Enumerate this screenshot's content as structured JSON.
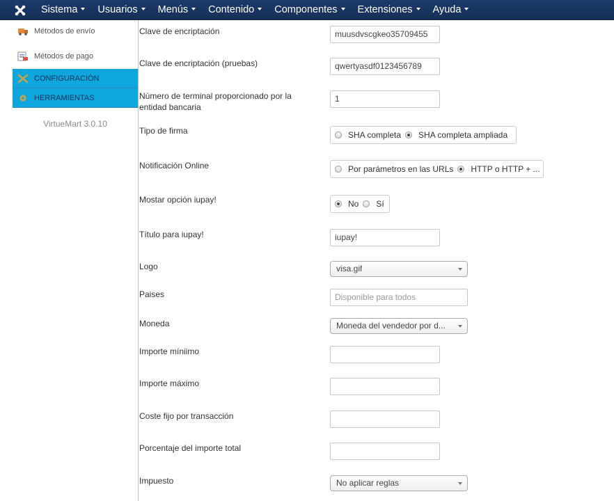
{
  "navbar": {
    "menu": [
      "Sistema",
      "Usuarios",
      "Menús",
      "Contenido",
      "Componentes",
      "Extensiones",
      "Ayuda"
    ]
  },
  "sidebar": {
    "items": [
      {
        "label": "Métodos de envío",
        "icon": "truck-icon"
      },
      {
        "label": "Métodos de pago",
        "icon": "payment-icon"
      },
      {
        "label": "CONFIGURACIÓN",
        "icon": "config-icon"
      },
      {
        "label": "HERRAMIENTAS",
        "icon": "tools-icon"
      }
    ],
    "version": "VirtueMart 3.0.10"
  },
  "form": {
    "encryption_key": {
      "label": "Clave de encriptación",
      "value": "muusdvscgkeo35709455"
    },
    "encryption_key_test": {
      "label": "Clave de encriptación (pruebas)",
      "value": "qwertyasdf0123456789"
    },
    "terminal": {
      "label_line1": "Número de terminal proporcionado por la",
      "label_line2": "entidad bancaria",
      "value": "1"
    },
    "signature_type": {
      "label": "Tipo de firma",
      "options": [
        "SHA completa",
        "SHA completa ampliada"
      ],
      "selected": 1
    },
    "online_notification": {
      "label": "Notificación Online",
      "options": [
        "Por parámetros en las URLs",
        "HTTP o HTTP + ..."
      ],
      "selected": 1
    },
    "show_iupay": {
      "label": "Mostar opción iupay!",
      "options": [
        "No",
        "Sí"
      ],
      "selected": 0
    },
    "iupay_title": {
      "label": "Título para iupay!",
      "value": "iupay!"
    },
    "logo": {
      "label": "Logo",
      "value": "visa.gif"
    },
    "countries": {
      "label": "Paises",
      "placeholder": "Disponible para todos"
    },
    "currency": {
      "label": "Moneda",
      "value": "Moneda del vendedor por d..."
    },
    "min_amount": {
      "label": "Importe míniimo",
      "value": ""
    },
    "max_amount": {
      "label": "Importe máximo",
      "value": ""
    },
    "fixed_fee": {
      "label": "Coste fijo por transacción",
      "value": ""
    },
    "percent_fee": {
      "label": "Porcentaje del importe total",
      "value": ""
    },
    "tax": {
      "label": "Impuesto",
      "value": "No aplicar reglas"
    }
  }
}
